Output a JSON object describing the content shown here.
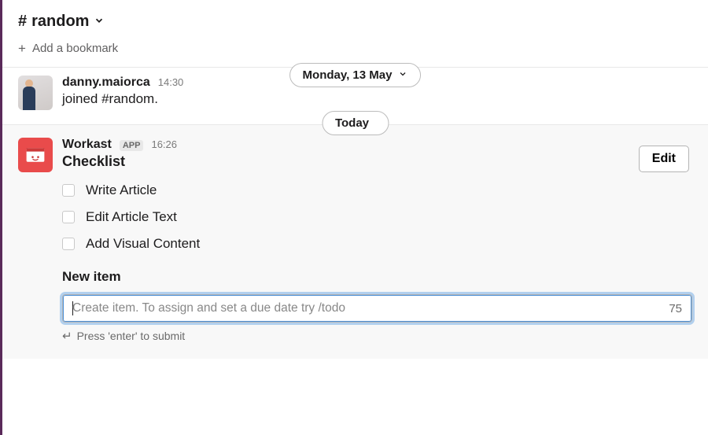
{
  "header": {
    "channel_name": "random"
  },
  "bookmark": {
    "add_label": "Add a bookmark"
  },
  "date_dividers": {
    "first": "Monday, 13 May",
    "second": "Today"
  },
  "messages": {
    "join": {
      "sender": "danny.maiorca",
      "time": "14:30",
      "text": "joined #random."
    },
    "workast": {
      "sender": "Workast",
      "badge": "APP",
      "time": "16:26",
      "checklist_title": "Checklist",
      "edit_label": "Edit",
      "items": [
        "Write Article",
        "Edit Article Text",
        "Add Visual Content"
      ],
      "new_item_label": "New item",
      "placeholder": "Create item. To assign and set a due date try /todo",
      "char_count": "75",
      "hint": "Press 'enter' to submit"
    }
  }
}
